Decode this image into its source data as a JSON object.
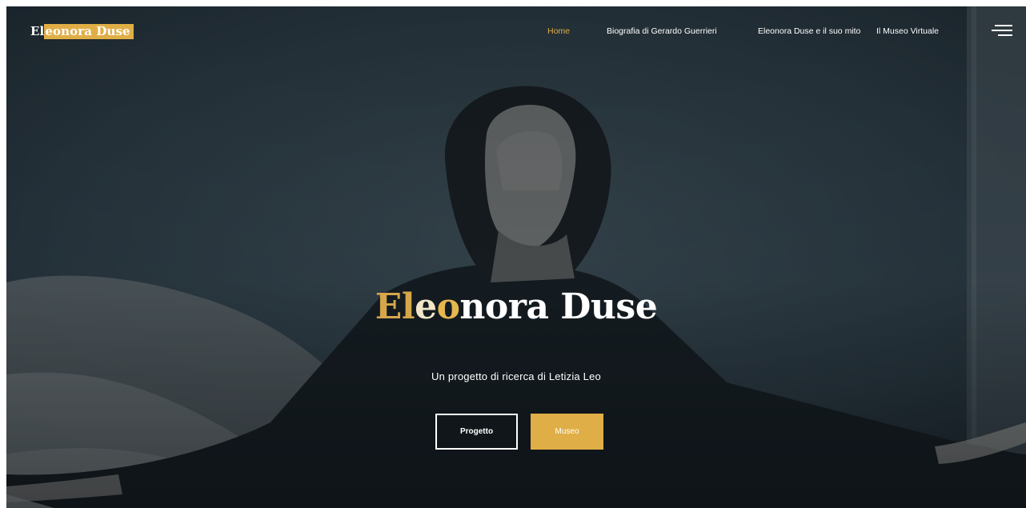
{
  "site": {
    "logo_highlight_start": "El",
    "logo_highlight_rest": "eonora Duse"
  },
  "nav": {
    "items": [
      {
        "label": "Home",
        "active": true
      },
      {
        "label": "Biografia di Gerardo Guerrieri",
        "active": false
      },
      {
        "label": "Eleonora Duse e il suo mito",
        "active": false
      },
      {
        "label": "Il Museo Virtuale",
        "active": false
      }
    ],
    "menu_icon": "hamburger-menu-icon"
  },
  "hero": {
    "title_part1": "El",
    "title_part2": "e",
    "title_part3": "o",
    "title_part4": "nora Duse",
    "subtitle": "Un progetto di ricerca di Letizia Leo",
    "buttons": {
      "primary": "Progetto",
      "secondary": "Museo"
    }
  },
  "colors": {
    "accent": "#e0ae46",
    "text": "#ffffff",
    "overlay": "#1e2830"
  }
}
